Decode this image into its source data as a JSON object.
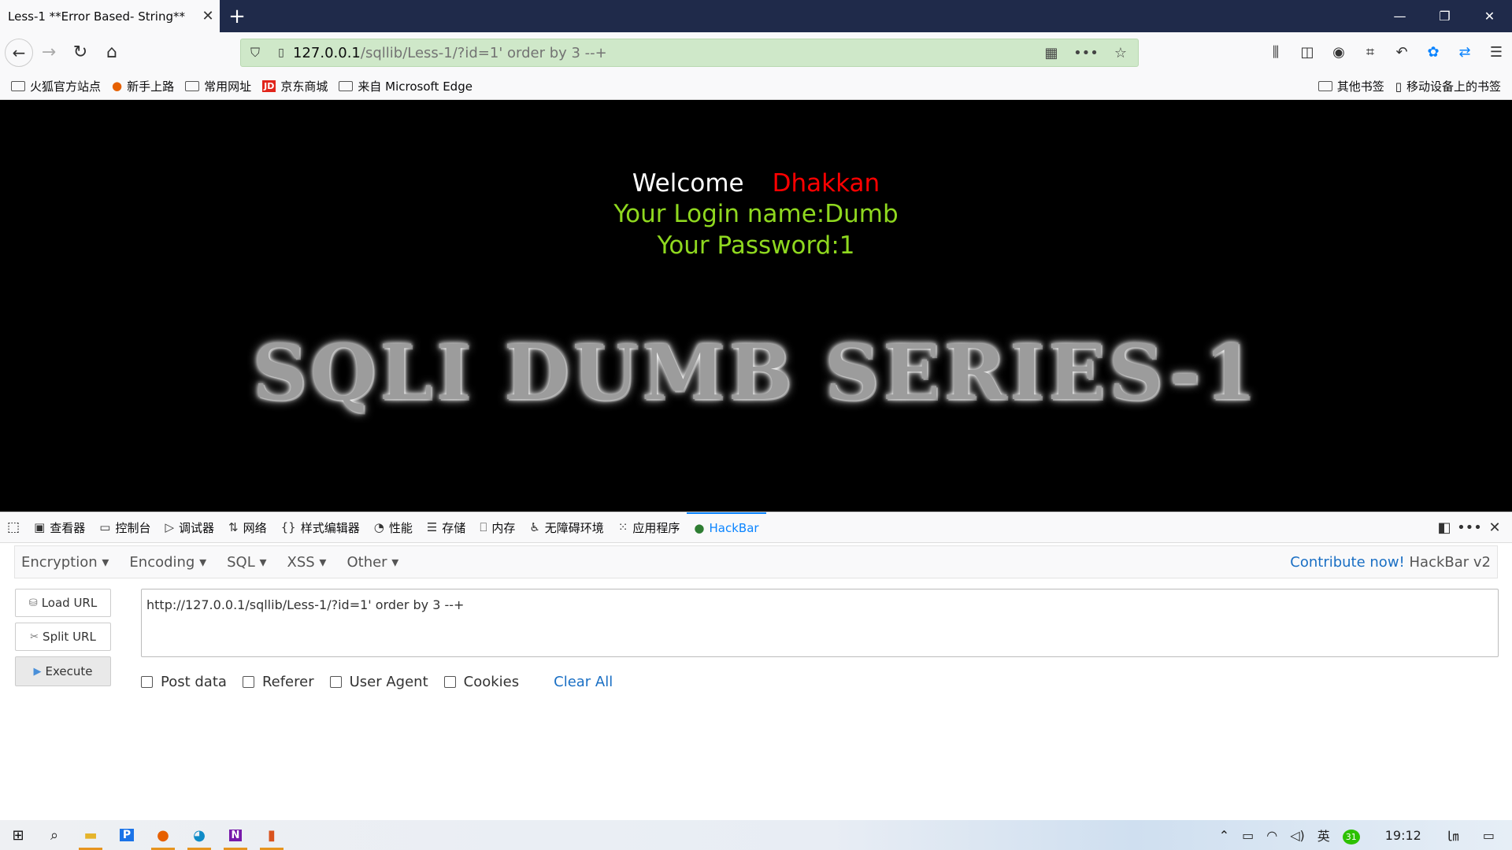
{
  "browser": {
    "tab_title": "Less-1 **Error Based- String**",
    "tab_close": "✕",
    "new_tab": "+",
    "url_host": "127.0.0.1",
    "url_path": "/sqllib/Less-1/?id=1' order by 3 --+"
  },
  "bookmarks": {
    "left": [
      {
        "label": "火狐官方站点",
        "icon": "folder-icon"
      },
      {
        "label": "新手上路",
        "icon": "firefox-icon"
      },
      {
        "label": "常用网址",
        "icon": "folder-icon"
      },
      {
        "label": "京东商城",
        "icon": "jd-icon"
      },
      {
        "label": "来自 Microsoft Edge",
        "icon": "folder-icon"
      }
    ],
    "right": [
      {
        "label": "其他书签",
        "icon": "folder-icon"
      },
      {
        "label": "移动设备上的书签",
        "icon": "mobile-icon"
      }
    ]
  },
  "page": {
    "welcome": "Welcome",
    "user": "Dhakkan",
    "login_name": "Your Login name:Dumb",
    "password": "Your Password:1",
    "banner": "SQLI DUMB SERIES-1"
  },
  "devtools": {
    "tabs": [
      {
        "label": "查看器",
        "icon": "inspector-icon"
      },
      {
        "label": "控制台",
        "icon": "console-icon"
      },
      {
        "label": "调试器",
        "icon": "debugger-icon"
      },
      {
        "label": "网络",
        "icon": "network-icon"
      },
      {
        "label": "样式编辑器",
        "icon": "style-editor-icon"
      },
      {
        "label": "性能",
        "icon": "performance-icon"
      },
      {
        "label": "存储",
        "icon": "storage-icon"
      },
      {
        "label": "内存",
        "icon": "memory-icon"
      },
      {
        "label": "无障碍环境",
        "icon": "accessibility-icon"
      },
      {
        "label": "应用程序",
        "icon": "application-icon"
      },
      {
        "label": "HackBar",
        "icon": "hackbar-icon"
      }
    ]
  },
  "hackbar": {
    "menus": [
      "Encryption",
      "Encoding",
      "SQL",
      "XSS",
      "Other"
    ],
    "contribute": "Contribute now!",
    "version": "HackBar v2",
    "load_url": "Load URL",
    "split_url": "Split URL",
    "execute": "Execute",
    "url_value": "http://127.0.0.1/sqllib/Less-1/?id=1' order by 3 --+",
    "options": [
      "Post data",
      "Referer",
      "User Agent",
      "Cookies"
    ],
    "clear_all": "Clear All"
  },
  "taskbar": {
    "ime": "英",
    "clock": "19:12",
    "badge": "31"
  },
  "colors": {
    "accent": "#0a84ff",
    "welcome_name": "#ff0000",
    "login_text": "#8fd81f",
    "url_bar": "#cfe8c9",
    "titlebar": "#1f2a4a"
  }
}
